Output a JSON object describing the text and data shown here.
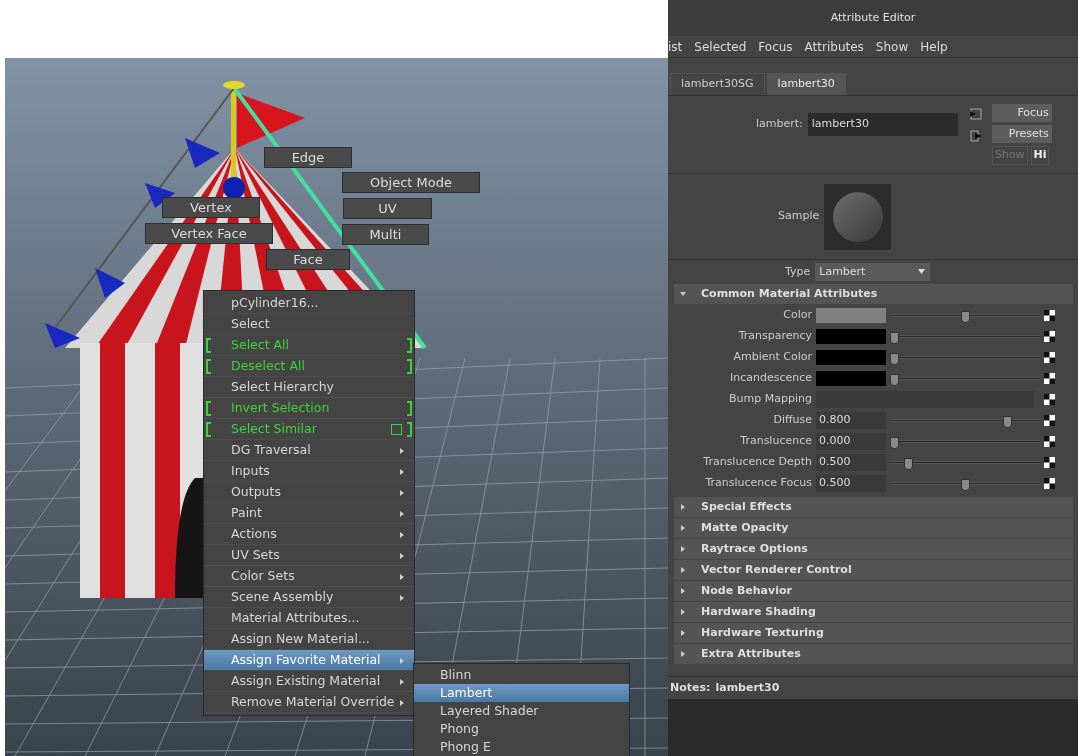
{
  "marking_menu": [
    {
      "label": "Edge"
    },
    {
      "label": "Object Mode"
    },
    {
      "label": "Vertex"
    },
    {
      "label": "UV"
    },
    {
      "label": "Vertex Face"
    },
    {
      "label": "Multi"
    },
    {
      "label": "Face"
    }
  ],
  "context_menu": {
    "items": [
      {
        "label": "pCylinder16...",
        "kind": "header",
        "selected": false
      },
      {
        "label": "Select",
        "kind": "item",
        "selected": false
      },
      {
        "label": "Select All",
        "kind": "bracketed",
        "selected": false
      },
      {
        "label": "Deselect All",
        "kind": "bracketed",
        "selected": false
      },
      {
        "label": "Select Hierarchy",
        "kind": "item",
        "selected": false
      },
      {
        "label": "Invert Selection",
        "kind": "bracketed",
        "selected": false
      },
      {
        "label": "Select Similar",
        "kind": "bracketed_option",
        "selected": false
      },
      {
        "label": "DG Traversal",
        "kind": "submenu",
        "selected": false
      },
      {
        "label": "Inputs",
        "kind": "submenu",
        "selected": false
      },
      {
        "label": "Outputs",
        "kind": "submenu",
        "selected": false
      },
      {
        "label": "Paint",
        "kind": "submenu",
        "selected": false
      },
      {
        "label": "Actions",
        "kind": "submenu",
        "selected": false
      },
      {
        "label": "UV Sets",
        "kind": "submenu",
        "selected": false
      },
      {
        "label": "Color Sets",
        "kind": "submenu",
        "selected": false
      },
      {
        "label": "Scene Assembly",
        "kind": "submenu",
        "selected": false
      },
      {
        "label": "Material Attributes...",
        "kind": "item",
        "selected": false
      },
      {
        "label": "Assign New Material...",
        "kind": "item",
        "selected": false
      },
      {
        "label": "Assign Favorite Material",
        "kind": "submenu",
        "selected": true
      },
      {
        "label": "Assign Existing Material",
        "kind": "submenu",
        "selected": false
      },
      {
        "label": "Remove Material Override",
        "kind": "submenu",
        "selected": false
      }
    ],
    "submenu": [
      {
        "label": "Blinn",
        "selected": false
      },
      {
        "label": "Lambert",
        "selected": true
      },
      {
        "label": "Layered Shader",
        "selected": false
      },
      {
        "label": "Phong",
        "selected": false
      },
      {
        "label": "Phong E",
        "selected": false
      }
    ]
  },
  "attribute_editor": {
    "title": "Attribute Editor",
    "menu": [
      "ist",
      "Selected",
      "Focus",
      "Attributes",
      "Show",
      "Help"
    ],
    "tabs": [
      {
        "label": "lambert30SG",
        "selected": false
      },
      {
        "label": "lambert30",
        "selected": true
      }
    ],
    "node_label": "lambert:",
    "node_name": "lambert30",
    "buttons": [
      "Focus",
      "Presets"
    ],
    "small_buttons": [
      "Show",
      "Hi"
    ],
    "sample_label": "Sample",
    "type_label": "Type",
    "type_value": "Lambert",
    "sections": [
      {
        "title": "Common Material Attributes",
        "expanded": true,
        "attributes": [
          {
            "label": "Color",
            "kind": "swatch",
            "color": "#808080",
            "level": 0.5
          },
          {
            "label": "Transparency",
            "kind": "swatch",
            "color": "#000000",
            "level": 0
          },
          {
            "label": "Ambient Color",
            "kind": "swatch",
            "color": "#000000",
            "level": 0
          },
          {
            "label": "Incandescence",
            "kind": "swatch",
            "color": "#000000",
            "level": 0
          },
          {
            "label": "Bump Mapping",
            "kind": "map"
          },
          {
            "label": "Diffuse",
            "kind": "number",
            "value": "0.800",
            "level": 0.8
          },
          {
            "label": "Translucence",
            "kind": "number",
            "value": "0.000",
            "level": 0
          },
          {
            "label": "Translucence Depth",
            "kind": "number",
            "value": "0.500",
            "level": 0.1
          },
          {
            "label": "Translucence Focus",
            "kind": "number",
            "value": "0.500",
            "level": 0.5
          }
        ]
      },
      {
        "title": "Special Effects",
        "expanded": false
      },
      {
        "title": "Matte Opacity",
        "expanded": false
      },
      {
        "title": "Raytrace Options",
        "expanded": false
      },
      {
        "title": "Vector Renderer Control",
        "expanded": false
      },
      {
        "title": "Node Behavior",
        "expanded": false
      },
      {
        "title": "Hardware Shading",
        "expanded": false
      },
      {
        "title": "Hardware Texturing",
        "expanded": false
      },
      {
        "title": "Extra Attributes",
        "expanded": false
      }
    ],
    "notes_label": "Notes:",
    "notes_name": "lambert30"
  }
}
